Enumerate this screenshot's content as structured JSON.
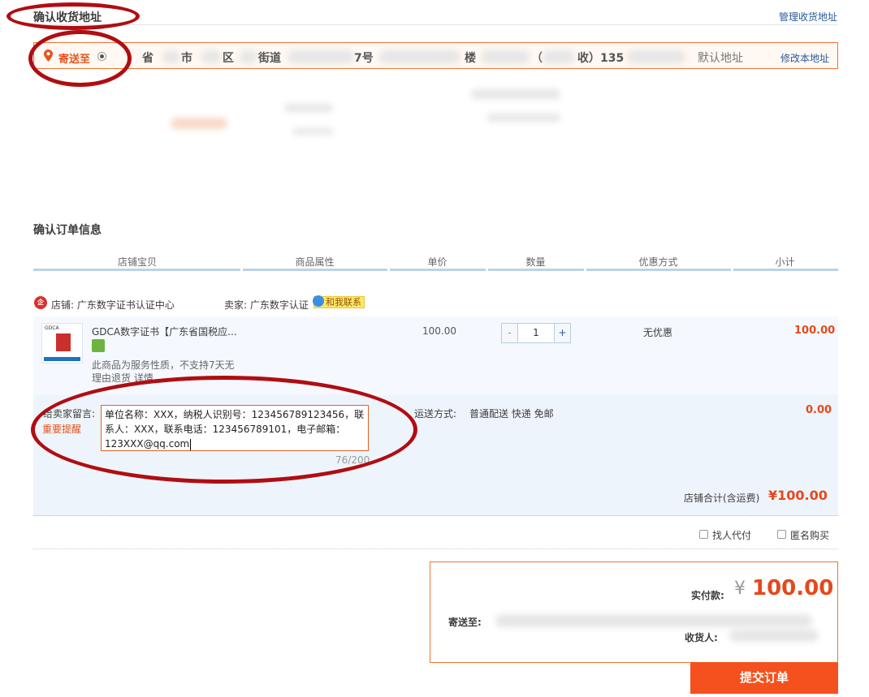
{
  "address": {
    "title": "确认收货地址",
    "manage_link": "管理收货地址",
    "ship_to_label": "寄送至",
    "fragments": {
      "province": "省",
      "city": "市",
      "district": "区",
      "street": "街道",
      "number": "7号",
      "building": "楼",
      "paren": "（",
      "receiver": "收）135"
    },
    "default_label": "默认地址",
    "edit_link": "修改本地址"
  },
  "order": {
    "title": "确认订单信息",
    "columns": [
      "店铺宝贝",
      "商品属性",
      "单价",
      "数量",
      "优惠方式",
      "小计"
    ],
    "shop_label": "店铺: 广东数字证书认证中心",
    "seller_label": "卖家: 广东数字认证",
    "contact_label": "和我联系",
    "contact_count": "1",
    "item": {
      "thumb_text": "GDCA",
      "title": "GDCA数字证书【广东省国税应...",
      "note": "此商品为服务性质，不支持7天无理由退货 详情",
      "price": "100.00",
      "minus": "-",
      "quantity": "1",
      "plus": "+",
      "discount": "无优惠",
      "subtotal": "100.00"
    },
    "message": {
      "label": "给卖家留言:",
      "reminder": "重要提醒",
      "value": "单位名称：XXX，纳税人识别号：123456789123456，联系人：XXX，联系电话：123456789101，电子邮箱：123XXX@qq.com",
      "counter": "76/200"
    },
    "shipping": {
      "label": "运送方式:",
      "value": "普通配送 快递 免邮",
      "fee": "0.00"
    },
    "shop_total_label": "店铺合计(含运费)",
    "shop_total": "¥100.00",
    "options": {
      "proxy_pay": "找人代付",
      "anonymous": "匿名购买"
    }
  },
  "payment": {
    "amount_label": "实付款:",
    "currency": "¥",
    "amount": "100.00",
    "ship_to_label": "寄送至:",
    "receiver_label": "收货人:",
    "submit": "提交订单"
  },
  "colors": {
    "accent_orange": "#f4511e",
    "price_red": "#e4491c",
    "annotation_red": "#b00d12",
    "link_blue": "#2a5b9c"
  }
}
